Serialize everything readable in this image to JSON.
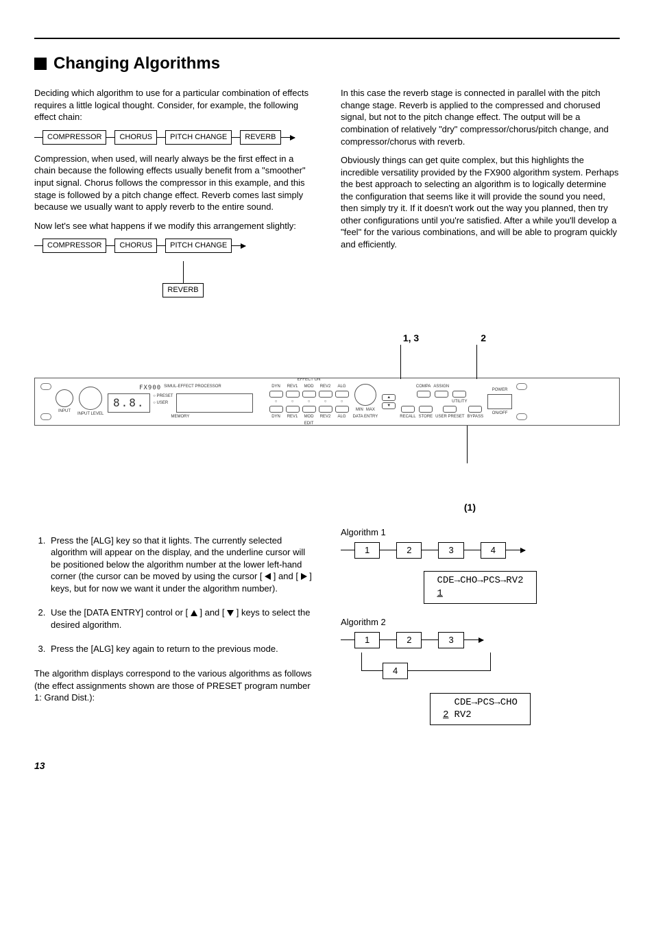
{
  "title": "Changing Algorithms",
  "intro_para": "Deciding which algorithm to use for a particular combination of effects requires a little logical thought. Consider, for example, the following effect chain:",
  "chain1": {
    "b1": "COMPRESSOR",
    "b2": "CHORUS",
    "b3": "PITCH CHANGE",
    "b4": "REVERB"
  },
  "para2": "Compression, when used, will nearly always be the first effect in a chain because the following effects usually benefit from a \"smoother\" input signal. Chorus follows the compressor in this example, and this stage is followed by a pitch change effect. Reverb comes last simply because we usually want to apply reverb to the entire sound.",
  "para3": "Now let's see what happens if we modify this arrangement slightly:",
  "chain2": {
    "b1": "COMPRESSOR",
    "b2": "CHORUS",
    "b3": "PITCH CHANGE",
    "b4": "REVERB"
  },
  "right_para1": "In this case the reverb stage is connected in parallel with the pitch change stage. Reverb is applied to the compressed and chorused signal, but not to the pitch change effect. The output will be a combination of relatively \"dry\" compressor/chorus/pitch change, and compressor/chorus with reverb.",
  "right_para2": "Obviously things can get quite complex, but this highlights the incredible versatility provided by the FX900 algorithm system. Perhaps the best approach to selecting an algorithm is to logically determine the configuration that seems like it will provide the sound you need, then simply try it. If it doesn't work out the way you planned, then try other configurations until you're satisfied. After a while you'll develop a \"feel\" for the various combinations, and will be able to program quickly and efficiently.",
  "panel_labels": {
    "l1": "1, 3",
    "l2": "2"
  },
  "panel": {
    "brand": "FX900",
    "subtitle": "SIMUL-EFFECT PROCESSOR",
    "display": "8.8.",
    "preset": "PRESET",
    "user": "USER",
    "memory": "MEMORY",
    "input": "INPUT",
    "level": "INPUT LEVEL",
    "effect_on": "EFFECT ON",
    "edit": "EDIT",
    "dyn": "DYN",
    "rev1": "REV1",
    "mod": "MOD",
    "rev2": "REV2",
    "alg": "ALG",
    "data_entry": "DATA ENTRY",
    "min": "MIN",
    "max": "MAX",
    "compa": "COMPA",
    "assign": "ASSIGN",
    "recall": "RECALL",
    "store": "STORE",
    "user_preset": "USER PRESET",
    "bypass": "BYPASS",
    "utility": "UTILITY",
    "power": "POWER",
    "power_sub": "ON/OFF"
  },
  "callout1": "(1)",
  "steps": {
    "s1a": "Press the [ALG] key so that it lights. The currently selected algorithm will appear on the display, and the underline cursor will be positioned below the algorithm number at the lower left-hand corner (the cursor can be moved by using the cursor [",
    "s1b": "] and [",
    "s1c": "] keys, but for now we want it under the algorithm number).",
    "s2a": "Use the [DATA ENTRY] control or [",
    "s2b": "] and [",
    "s2c": "] keys to select the desired algorithm.",
    "s3": "Press the [ALG] key again to return to the previous mode."
  },
  "closing_para": "The algorithm displays correspond to the various algorithms as follows (the effect assignments shown are those of PRESET program number 1: Grand Dist.):",
  "alg1": {
    "title": "Algorithm 1",
    "n1": "1",
    "n2": "2",
    "n3": "3",
    "n4": "4",
    "disp": "CDE→CHO→PCS→RV2",
    "dispnum": "1"
  },
  "alg2": {
    "title": "Algorithm 2",
    "n1": "1",
    "n2": "2",
    "n3": "3",
    "n4": "4",
    "disp_top": "CDE→PCS→CHO",
    "disp_num": "2",
    "disp_bot": "RV2"
  },
  "page_number": "13"
}
